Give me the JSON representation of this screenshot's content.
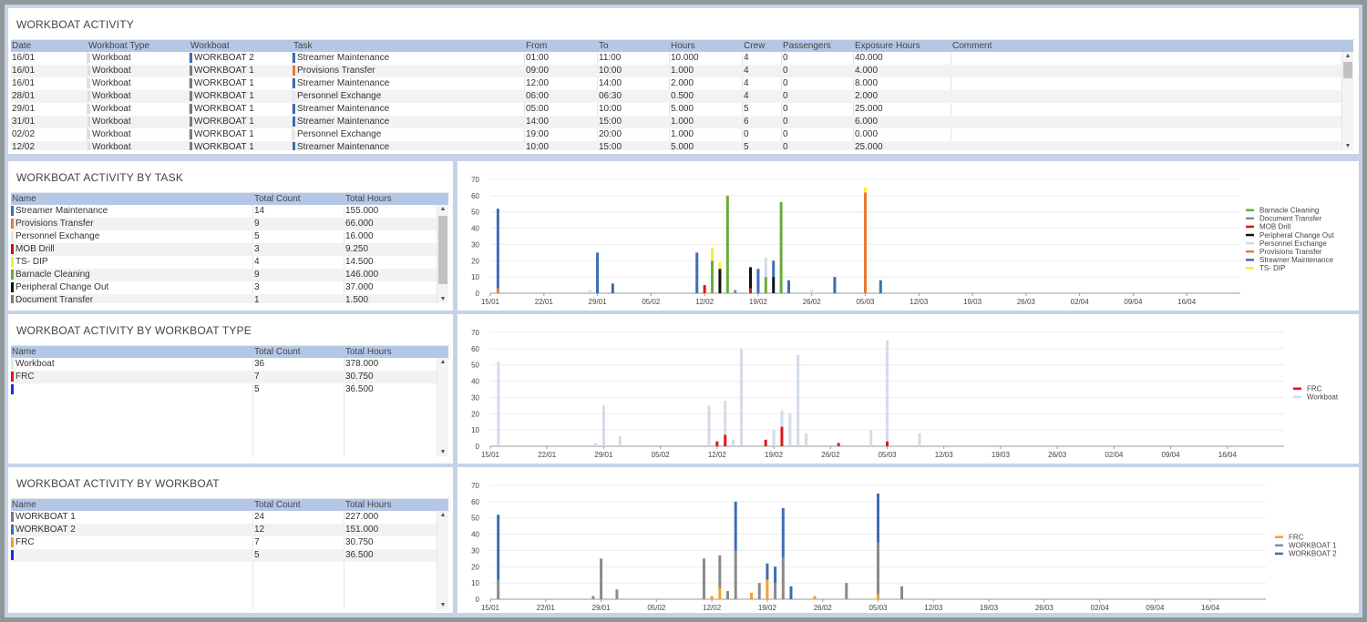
{
  "activity": {
    "title": "WORKBOAT ACTIVITY",
    "headers": [
      "Date",
      "Workboat Type",
      "Workboat",
      "Task",
      "From",
      "To",
      "Hours",
      "Crew",
      "Passengers",
      "Exposure Hours",
      "Comment"
    ],
    "rows": [
      {
        "date": "16/01",
        "type": "Workboat",
        "type_color": "#d9dde6",
        "boat": "WORKBOAT 2",
        "boat_color": "#3d6db5",
        "task": "Streamer Maintenance",
        "task_color": "#3d6db5",
        "from": "01:00",
        "to": "11:00",
        "hours": "10.000",
        "crew": "4",
        "passengers": "0",
        "exposure": "40.000",
        "comment": ""
      },
      {
        "date": "16/01",
        "type": "Workboat",
        "type_color": "#d9dde6",
        "boat": "WORKBOAT 1",
        "boat_color": "#7a7a7a",
        "task": "Provisions Transfer",
        "task_color": "#e97a32",
        "from": "09:00",
        "to": "10:00",
        "hours": "1.000",
        "crew": "4",
        "passengers": "0",
        "exposure": "4.000",
        "comment": ""
      },
      {
        "date": "16/01",
        "type": "Workboat",
        "type_color": "#d9dde6",
        "boat": "WORKBOAT 1",
        "boat_color": "#7a7a7a",
        "task": "Streamer Maintenance",
        "task_color": "#3d6db5",
        "from": "12:00",
        "to": "14:00",
        "hours": "2.000",
        "crew": "4",
        "passengers": "0",
        "exposure": "8.000",
        "comment": ""
      },
      {
        "date": "28/01",
        "type": "Workboat",
        "type_color": "#d9dde6",
        "boat": "WORKBOAT 1",
        "boat_color": "#7a7a7a",
        "task": "Personnel Exchange",
        "task_color": "#e6e6e6",
        "from": "06:00",
        "to": "06:30",
        "hours": "0.500",
        "crew": "4",
        "passengers": "0",
        "exposure": "2.000",
        "comment": ""
      },
      {
        "date": "29/01",
        "type": "Workboat",
        "type_color": "#d9dde6",
        "boat": "WORKBOAT 1",
        "boat_color": "#7a7a7a",
        "task": "Streamer Maintenance",
        "task_color": "#3d6db5",
        "from": "05:00",
        "to": "10:00",
        "hours": "5.000",
        "crew": "5",
        "passengers": "0",
        "exposure": "25.000",
        "comment": ""
      },
      {
        "date": "31/01",
        "type": "Workboat",
        "type_color": "#d9dde6",
        "boat": "WORKBOAT 1",
        "boat_color": "#7a7a7a",
        "task": "Streamer Maintenance",
        "task_color": "#3d6db5",
        "from": "14:00",
        "to": "15:00",
        "hours": "1.000",
        "crew": "6",
        "passengers": "0",
        "exposure": "6.000",
        "comment": ""
      },
      {
        "date": "02/02",
        "type": "Workboat",
        "type_color": "#d9dde6",
        "boat": "WORKBOAT 1",
        "boat_color": "#7a7a7a",
        "task": "Personnel Exchange",
        "task_color": "#e6e6e6",
        "from": "19:00",
        "to": "20:00",
        "hours": "1.000",
        "crew": "0",
        "passengers": "0",
        "exposure": "0.000",
        "comment": ""
      },
      {
        "date": "12/02",
        "type": "Workboat",
        "type_color": "#d9dde6",
        "boat": "WORKBOAT 1",
        "boat_color": "#7a7a7a",
        "task": "Streamer Maintenance",
        "task_color": "#3d6db5",
        "from": "10:00",
        "to": "15:00",
        "hours": "5.000",
        "crew": "5",
        "passengers": "0",
        "exposure": "25.000",
        "comment": ""
      }
    ]
  },
  "by_task": {
    "title": "WORKBOAT ACTIVITY BY TASK",
    "headers": [
      "Name",
      "Total Count",
      "Total Hours"
    ],
    "rows": [
      {
        "name": "Streamer Maintenance",
        "color": "#3d6db5",
        "count": "14",
        "hours": "155.000"
      },
      {
        "name": "Provisions Transfer",
        "color": "#e97a32",
        "count": "9",
        "hours": "66.000"
      },
      {
        "name": "Personnel Exchange",
        "color": "#e6e6e6",
        "count": "5",
        "hours": "16.000"
      },
      {
        "name": "MOB Drill",
        "color": "#c0161c",
        "count": "3",
        "hours": "9.250"
      },
      {
        "name": "TS- DIP",
        "color": "#f5f032",
        "count": "4",
        "hours": "14.500"
      },
      {
        "name": "Barnacle Cleaning",
        "color": "#6aaa3a",
        "count": "9",
        "hours": "146.000"
      },
      {
        "name": "Peripheral Change Out",
        "color": "#111111",
        "count": "3",
        "hours": "37.000"
      },
      {
        "name": "Document Transfer",
        "color": "#7a7a7a",
        "count": "1",
        "hours": "1.500"
      }
    ]
  },
  "by_type": {
    "title": "WORKBOAT ACTIVITY BY WORKBOAT TYPE",
    "headers": [
      "Name",
      "Total Count",
      "Total Hours"
    ],
    "rows": [
      {
        "name": "Workboat",
        "color": "#e6e6e6",
        "count": "36",
        "hours": "378.000"
      },
      {
        "name": "FRC",
        "color": "#e0161c",
        "count": "7",
        "hours": "30.750"
      },
      {
        "name": "",
        "color": "#1a2ee0",
        "count": "5",
        "hours": "36.500"
      }
    ]
  },
  "by_boat": {
    "title": "WORKBOAT ACTIVITY BY WORKBOAT",
    "headers": [
      "Name",
      "Total Count",
      "Total Hours"
    ],
    "rows": [
      {
        "name": "WORKBOAT 1",
        "color": "#7a7a7a",
        "count": "24",
        "hours": "227.000"
      },
      {
        "name": "WORKBOAT 2",
        "color": "#3d6db5",
        "count": "12",
        "hours": "151.000"
      },
      {
        "name": "FRC",
        "color": "#f0a22a",
        "count": "7",
        "hours": "30.750"
      },
      {
        "name": "",
        "color": "#1a2ee0",
        "count": "5",
        "hours": "36.500"
      }
    ]
  },
  "chart_data": [
    {
      "type": "bar",
      "stacked": true,
      "xlabel": "",
      "ylabel": "",
      "ylim": [
        0,
        70
      ],
      "yticks": [
        0,
        10,
        20,
        30,
        40,
        50,
        60,
        70
      ],
      "grid": true,
      "legend_placement": "right",
      "x_tick_labels": [
        "15/01",
        "22/01",
        "29/01",
        "05/02",
        "12/02",
        "19/02",
        "26/02",
        "05/03",
        "12/03",
        "19/03",
        "26/03",
        "02/04",
        "09/04",
        "16/04"
      ],
      "x_range_days": [
        0,
        98
      ],
      "series": [
        {
          "name": "Barnacle Cleaning",
          "color": "#6aaa3a"
        },
        {
          "name": "Document Transfer",
          "color": "#8a8a8a"
        },
        {
          "name": "MOB Drill",
          "color": "#d01818"
        },
        {
          "name": "Peripheral Change Out",
          "color": "#111111"
        },
        {
          "name": "Personnel Exchange",
          "color": "#d3dbe8"
        },
        {
          "name": "Provisions Transfer",
          "color": "#e97a32"
        },
        {
          "name": "Streamer Maintenance",
          "color": "#3d6db5"
        },
        {
          "name": "TS- DIP",
          "color": "#f5f032"
        }
      ],
      "bars": [
        {
          "x": "16/01",
          "values": {
            "Provisions Transfer": 3,
            "Streamer Maintenance": 49
          }
        },
        {
          "x": "28/01",
          "values": {
            "Personnel Exchange": 2
          }
        },
        {
          "x": "29/01",
          "values": {
            "Streamer Maintenance": 25
          }
        },
        {
          "x": "31/01",
          "values": {
            "Streamer Maintenance": 6
          }
        },
        {
          "x": "11/02",
          "values": {
            "Streamer Maintenance": 25
          }
        },
        {
          "x": "12/02",
          "values": {
            "MOB Drill": 5
          }
        },
        {
          "x": "13/02",
          "values": {
            "Barnacle Cleaning": 20,
            "TS- DIP": 8
          }
        },
        {
          "x": "14/02",
          "values": {
            "Peripheral Change Out": 15,
            "TS- DIP": 4
          }
        },
        {
          "x": "15/02",
          "values": {
            "Barnacle Cleaning": 60
          }
        },
        {
          "x": "16/02",
          "values": {
            "Document Transfer": 2
          }
        },
        {
          "x": "18/02",
          "values": {
            "MOB Drill": 3,
            "Peripheral Change Out": 13
          }
        },
        {
          "x": "19/02",
          "values": {
            "Streamer Maintenance": 15
          }
        },
        {
          "x": "20/02",
          "values": {
            "Barnacle Cleaning": 10,
            "Personnel Exchange": 12
          }
        },
        {
          "x": "21/02",
          "values": {
            "Peripheral Change Out": 10,
            "Streamer Maintenance": 10
          }
        },
        {
          "x": "22/02",
          "values": {
            "Barnacle Cleaning": 56
          }
        },
        {
          "x": "23/02",
          "values": {
            "Streamer Maintenance": 8
          }
        },
        {
          "x": "26/02",
          "values": {
            "Personnel Exchange": 2
          }
        },
        {
          "x": "01/03",
          "values": {
            "Streamer Maintenance": 10
          }
        },
        {
          "x": "05/03",
          "values": {
            "Provisions Transfer": 62,
            "TS- DIP": 3
          }
        },
        {
          "x": "07/03",
          "values": {
            "Streamer Maintenance": 8
          }
        }
      ]
    },
    {
      "type": "bar",
      "stacked": true,
      "xlabel": "",
      "ylabel": "",
      "ylim": [
        0,
        70
      ],
      "yticks": [
        0,
        10,
        20,
        30,
        40,
        50,
        60,
        70
      ],
      "grid": true,
      "legend_placement": "right",
      "x_tick_labels": [
        "15/01",
        "22/01",
        "29/01",
        "05/02",
        "12/02",
        "19/02",
        "26/02",
        "05/03",
        "12/03",
        "19/03",
        "26/03",
        "02/04",
        "09/04",
        "16/04"
      ],
      "x_range_days": [
        0,
        98
      ],
      "series": [
        {
          "name": "FRC",
          "color": "#e0161c"
        },
        {
          "name": "Workboat",
          "color": "#d3dbe8"
        }
      ],
      "bars": [
        {
          "x": "16/01",
          "values": {
            "Workboat": 52
          }
        },
        {
          "x": "28/01",
          "values": {
            "Workboat": 2
          }
        },
        {
          "x": "29/01",
          "values": {
            "Workboat": 25
          }
        },
        {
          "x": "31/01",
          "values": {
            "Workboat": 6
          }
        },
        {
          "x": "11/02",
          "values": {
            "Workboat": 25
          }
        },
        {
          "x": "12/02",
          "values": {
            "FRC": 3
          }
        },
        {
          "x": "13/02",
          "values": {
            "FRC": 7,
            "Workboat": 21
          }
        },
        {
          "x": "14/02",
          "values": {
            "Workboat": 4
          }
        },
        {
          "x": "15/02",
          "values": {
            "Workboat": 60
          }
        },
        {
          "x": "18/02",
          "values": {
            "FRC": 4
          }
        },
        {
          "x": "19/02",
          "values": {
            "Workboat": 10
          }
        },
        {
          "x": "20/02",
          "values": {
            "FRC": 12,
            "Workboat": 10
          }
        },
        {
          "x": "21/02",
          "values": {
            "Workboat": 20
          }
        },
        {
          "x": "22/02",
          "values": {
            "Workboat": 56
          }
        },
        {
          "x": "23/02",
          "values": {
            "Workboat": 8
          }
        },
        {
          "x": "27/02",
          "values": {
            "FRC": 2
          }
        },
        {
          "x": "03/03",
          "values": {
            "Workboat": 10
          }
        },
        {
          "x": "05/03",
          "values": {
            "FRC": 3,
            "Workboat": 62
          }
        },
        {
          "x": "09/03",
          "values": {
            "Workboat": 8
          }
        }
      ]
    },
    {
      "type": "bar",
      "stacked": true,
      "xlabel": "",
      "ylabel": "",
      "ylim": [
        0,
        70
      ],
      "yticks": [
        0,
        10,
        20,
        30,
        40,
        50,
        60,
        70
      ],
      "grid": true,
      "legend_placement": "right",
      "x_tick_labels": [
        "15/01",
        "22/01",
        "29/01",
        "05/02",
        "12/02",
        "19/02",
        "26/02",
        "05/03",
        "12/03",
        "19/03",
        "26/03",
        "02/04",
        "09/04",
        "16/04"
      ],
      "x_range_days": [
        0,
        98
      ],
      "series": [
        {
          "name": "FRC",
          "color": "#f0a22a"
        },
        {
          "name": "WORKBOAT 1",
          "color": "#8a8a8a"
        },
        {
          "name": "WORKBOAT 2",
          "color": "#3d6db5"
        }
      ],
      "bars": [
        {
          "x": "16/01",
          "values": {
            "WORKBOAT 1": 12,
            "WORKBOAT 2": 40
          }
        },
        {
          "x": "28/01",
          "values": {
            "WORKBOAT 1": 2
          }
        },
        {
          "x": "29/01",
          "values": {
            "WORKBOAT 1": 25
          }
        },
        {
          "x": "31/01",
          "values": {
            "WORKBOAT 1": 6
          }
        },
        {
          "x": "11/02",
          "values": {
            "WORKBOAT 1": 25
          }
        },
        {
          "x": "12/02",
          "values": {
            "FRC": 2
          }
        },
        {
          "x": "13/02",
          "values": {
            "FRC": 7,
            "WORKBOAT 1": 20
          }
        },
        {
          "x": "14/02",
          "values": {
            "WORKBOAT 1": 5
          }
        },
        {
          "x": "15/02",
          "values": {
            "WORKBOAT 1": 30,
            "WORKBOAT 2": 30
          }
        },
        {
          "x": "17/02",
          "values": {
            "FRC": 4
          }
        },
        {
          "x": "18/02",
          "values": {
            "WORKBOAT 1": 10
          }
        },
        {
          "x": "19/02",
          "values": {
            "FRC": 12,
            "WORKBOAT 2": 10
          }
        },
        {
          "x": "20/02",
          "values": {
            "WORKBOAT 1": 10,
            "WORKBOAT 2": 10
          }
        },
        {
          "x": "21/02",
          "values": {
            "WORKBOAT 1": 26,
            "WORKBOAT 2": 30
          }
        },
        {
          "x": "22/02",
          "values": {
            "WORKBOAT 2": 8
          }
        },
        {
          "x": "25/02",
          "values": {
            "FRC": 2
          }
        },
        {
          "x": "01/03",
          "values": {
            "WORKBOAT 1": 10
          }
        },
        {
          "x": "05/03",
          "values": {
            "FRC": 3,
            "WORKBOAT 1": 32,
            "WORKBOAT 2": 30
          }
        },
        {
          "x": "08/03",
          "values": {
            "WORKBOAT 1": 8
          }
        }
      ]
    }
  ]
}
